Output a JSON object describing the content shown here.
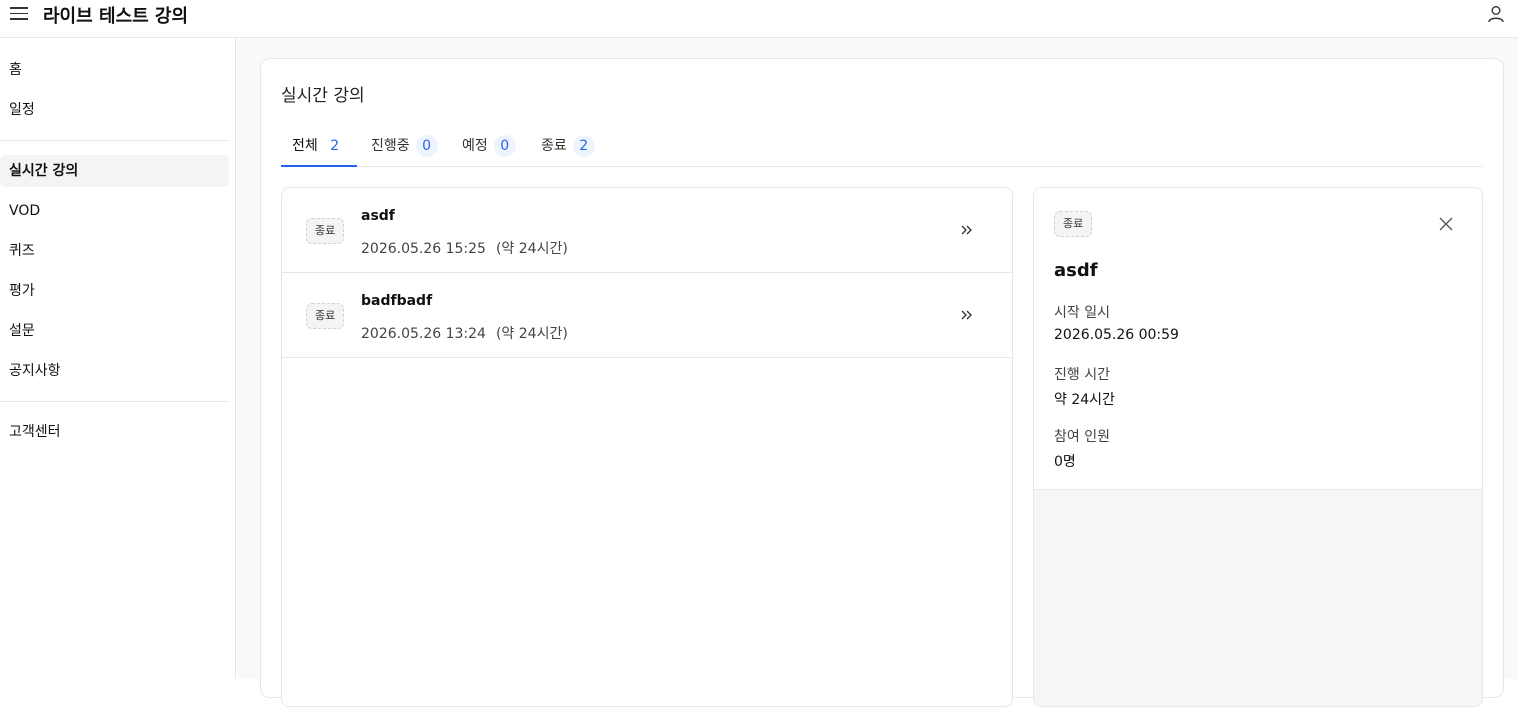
{
  "header": {
    "title": "라이브 테스트 강의"
  },
  "sidebar": {
    "items": [
      {
        "label": "홈"
      },
      {
        "label": "일정"
      },
      {
        "label": "실시간 강의"
      },
      {
        "label": "VOD"
      },
      {
        "label": "퀴즈"
      },
      {
        "label": "평가"
      },
      {
        "label": "설문"
      },
      {
        "label": "공지사항"
      },
      {
        "label": "고객센터"
      }
    ],
    "active": "실시간 강의"
  },
  "main": {
    "title": "실시간 강의",
    "tabs": [
      {
        "label": "전체",
        "count": "2"
      },
      {
        "label": "진행중",
        "count": "0"
      },
      {
        "label": "예정",
        "count": "0"
      },
      {
        "label": "종료",
        "count": "2"
      }
    ],
    "active_tab": "전체",
    "list": [
      {
        "status": "종료",
        "title": "asdf",
        "datetime": "2026.05.26 15:25",
        "duration": "(약 24시간)"
      },
      {
        "status": "종료",
        "title": "badfbadf",
        "datetime": "2026.05.26 13:24",
        "duration": "(약 24시간)"
      }
    ],
    "detail": {
      "status": "종료",
      "title": "asdf",
      "start_label": "시작 일시",
      "start_value": "2026.05.26 00:59",
      "duration_label": "진행 시간",
      "duration_value": "약 24시간",
      "participants_label": "참여 인원",
      "participants_value": "0명"
    }
  },
  "colors": {
    "accent": "#2563eb",
    "border": "#e5e7eb",
    "background": "#f8f9fb"
  },
  "icons": {
    "menu": "hamburger-icon",
    "user": "user-icon",
    "chevron": "double-chevron-right-icon",
    "close": "close-icon"
  }
}
